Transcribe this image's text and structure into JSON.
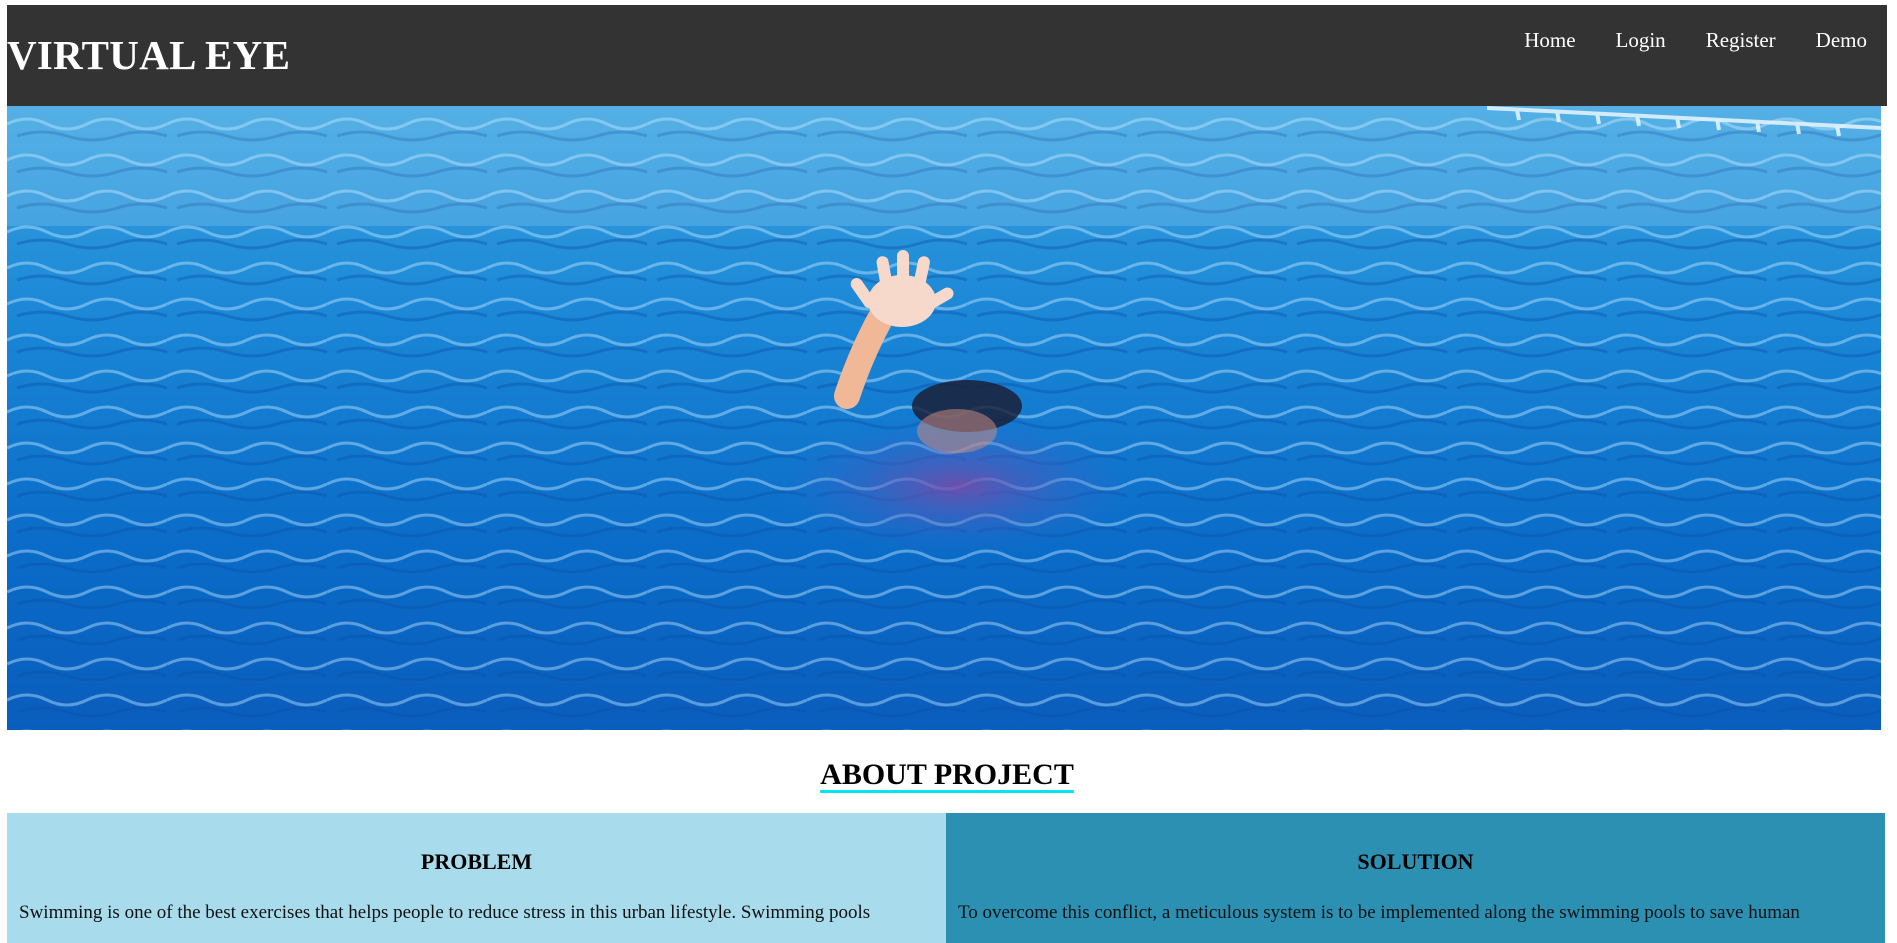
{
  "header": {
    "brand": "VIRTUAL EYE",
    "nav": [
      "Home",
      "Login",
      "Register",
      "Demo"
    ]
  },
  "hero": {
    "alt": "swimming pool with raised hand of a drowning child"
  },
  "about": {
    "title": "ABOUT PROJECT"
  },
  "problem": {
    "title": "PROBLEM",
    "text": "Swimming is one of the best exercises that helps people to reduce stress in this urban lifestyle. Swimming pools"
  },
  "solution": {
    "title": "SOLUTION",
    "text": "To overcome this conflict, a meticulous system is to be implemented along the swimming pools to save human"
  },
  "colors": {
    "header_bg": "#333333",
    "problem_bg": "#a8dbeb",
    "solution_bg": "#2b90b2",
    "underline": "#00e5ee"
  }
}
